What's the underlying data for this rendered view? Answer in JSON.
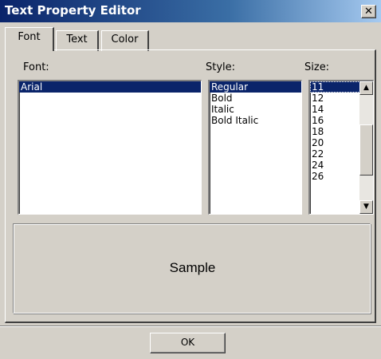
{
  "window": {
    "title": "Text Property Editor",
    "close_label": "✕"
  },
  "tabs": [
    {
      "label": "Font",
      "active": true
    },
    {
      "label": "Text",
      "active": false
    },
    {
      "label": "Color",
      "active": false
    }
  ],
  "font": {
    "label": "Font:",
    "items": [
      "Arial"
    ],
    "selected": "Arial"
  },
  "style": {
    "label": "Style:",
    "items": [
      "Regular",
      "Bold",
      "Italic",
      "Bold Italic"
    ],
    "selected": "Regular"
  },
  "size": {
    "label": "Size:",
    "items": [
      "11",
      "12",
      "14",
      "16",
      "18",
      "20",
      "22",
      "24",
      "26"
    ],
    "selected": "11",
    "scroll_up_icon": "▲",
    "scroll_down_icon": "▼"
  },
  "preview": {
    "text": "Sample"
  },
  "ok_label": "OK"
}
